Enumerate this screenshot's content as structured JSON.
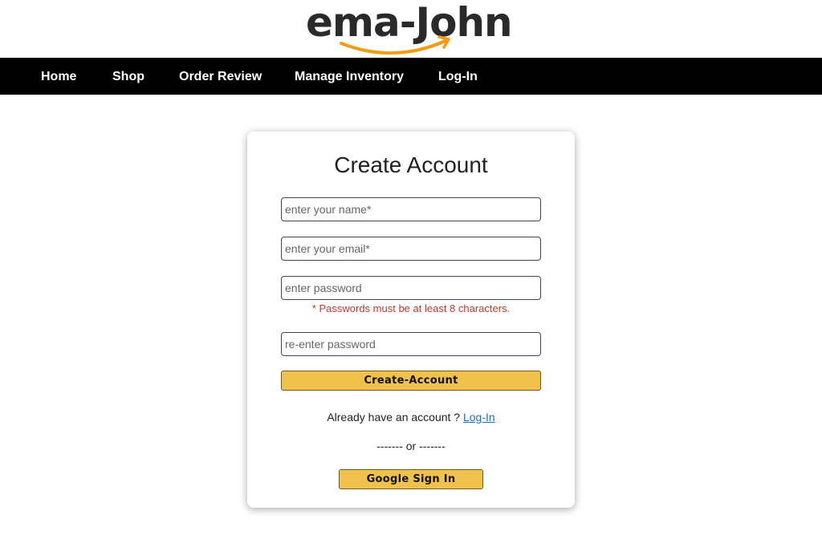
{
  "brand": {
    "logo_text": "ema-John",
    "smile_color": "#f39c12"
  },
  "nav": {
    "items": [
      {
        "label": "Home"
      },
      {
        "label": "Shop"
      },
      {
        "label": "Order Review"
      },
      {
        "label": "Manage Inventory"
      },
      {
        "label": "Log-In"
      }
    ]
  },
  "form": {
    "title": "Create Account",
    "name_placeholder": "enter your name*",
    "email_placeholder": "enter your email*",
    "password_placeholder": "enter password",
    "password_error": "* Passwords must be at least 8 characters.",
    "confirm_placeholder": "re-enter password",
    "submit_label": "Create-Account",
    "already_text": "Already have an account ?",
    "login_link": "Log-In",
    "divider": "------- or -------",
    "google_label": "Google Sign In"
  },
  "colors": {
    "nav_bg": "#000000",
    "button_bg": "#f0c14b",
    "error": "#c0392b",
    "link": "#1f6fbf"
  }
}
